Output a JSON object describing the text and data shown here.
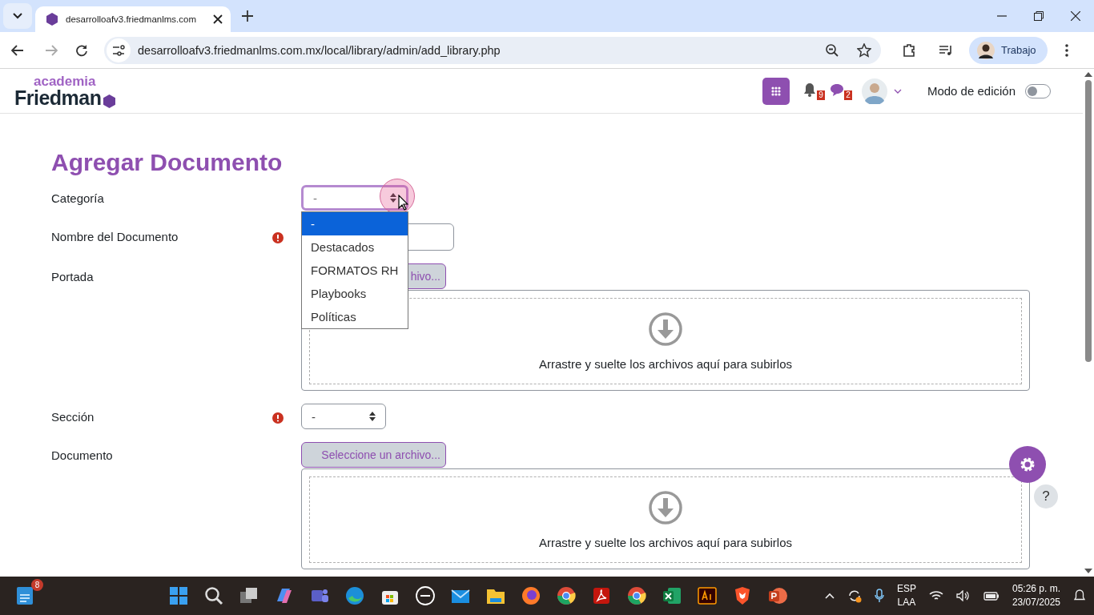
{
  "browser": {
    "tab_title": "desarrolloafv3.friedmanlms.com",
    "url": "desarrolloafv3.friedmanlms.com.mx/local/library/admin/add_library.php",
    "profile": "Trabajo"
  },
  "header": {
    "logo_top": "academia",
    "logo_bottom": "Friedman",
    "notifications_count": "9",
    "messages_count": "2",
    "edit_mode": {
      "label": "Modo de edición",
      "on": false
    }
  },
  "form": {
    "title": "Agregar Documento",
    "fields": [
      {
        "kind": "select",
        "label": "Categoría",
        "required": false,
        "value": "-",
        "open": true,
        "options": [
          {
            "label": "-",
            "selected": true
          },
          {
            "label": "Destacados",
            "selected": false
          },
          {
            "label": "FORMATOS RH",
            "selected": false
          },
          {
            "label": "Playbooks",
            "selected": false
          },
          {
            "label": "Políticas",
            "selected": false
          }
        ]
      },
      {
        "kind": "text",
        "label": "Nombre del Documento",
        "required": true
      },
      {
        "kind": "file",
        "label": "Portada",
        "required": false,
        "button": "hivo...",
        "dropzone": "Arrastre y suelte los archivos aquí para subirlos"
      },
      {
        "kind": "select",
        "label": "Sección",
        "required": true,
        "value": "-",
        "open": false
      },
      {
        "kind": "file",
        "label": "Documento",
        "required": false,
        "button": "Seleccione un archivo...",
        "dropzone": "Arrastre y suelte los archivos aquí para subirlos"
      }
    ]
  },
  "help": "?",
  "taskbar": {
    "widget_badge": "8",
    "language": "ESP",
    "layout": "LAA",
    "time": "05:26 p. m.",
    "date": "23/07/2025"
  }
}
